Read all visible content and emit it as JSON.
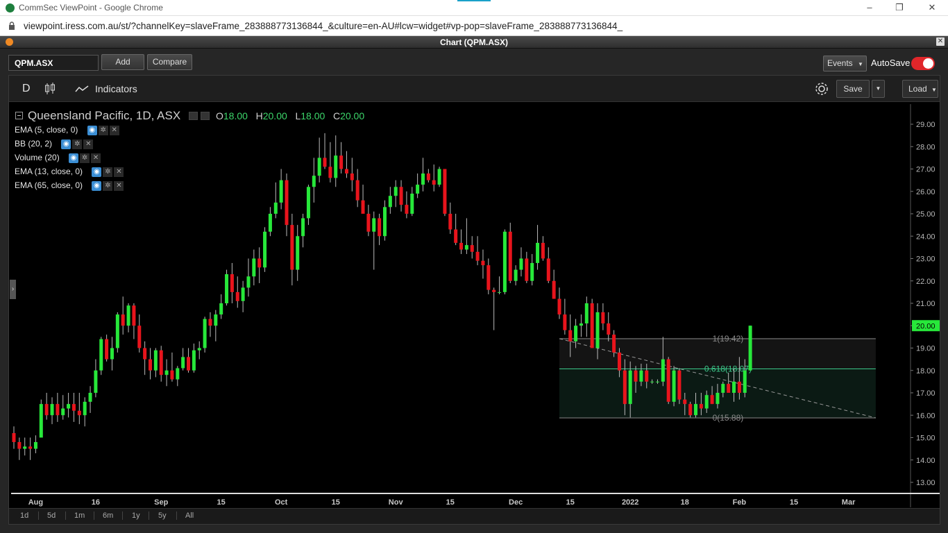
{
  "browser": {
    "window_title": "CommSec ViewPoint - Google Chrome",
    "url": "viewpoint.iress.com.au/st/?channelKey=slaveFrame_283888773136844_&culture=en-AU#lcw=widget#vp-pop=slaveFrame_283888773136844_",
    "controls": {
      "minimize": "–",
      "restore": "❐",
      "close": "✕"
    }
  },
  "widget": {
    "title": "Chart (QPM.ASX)",
    "close_icon": "✕"
  },
  "toolbar": {
    "symbol_value": "QPM.ASX",
    "add_label": "Add",
    "compare_label": "Compare",
    "events_label": "Events",
    "autosave_label": "AutoSave",
    "autosave_on": true
  },
  "chart_toolbar": {
    "period_label": "D",
    "indicators_label": "Indicators",
    "save_label": "Save",
    "load_label": "Load"
  },
  "legend": {
    "title": "Queensland Pacific, 1D, ASX",
    "o_label": "O",
    "o_value": "18.00",
    "h_label": "H",
    "h_value": "20.00",
    "l_label": "L",
    "l_value": "18.00",
    "c_label": "C",
    "c_value": "20.00",
    "studies": [
      "EMA (5, close, 0)",
      "BB (20, 2)",
      "Volume (20)",
      "EMA (13, close, 0)",
      "EMA (65, close, 0)"
    ]
  },
  "range_buttons": [
    "1d",
    "5d",
    "1m",
    "6m",
    "1y",
    "5y",
    "All"
  ],
  "colors": {
    "up": "#27e83a",
    "down": "#e8141c",
    "fib": "#3cc98a",
    "accent": "#f08a24"
  },
  "chart_data": {
    "type": "candlestick",
    "title": "Queensland Pacific, 1D, ASX",
    "ylim": [
      12.5,
      29.5
    ],
    "y_ticks": [
      "29.00",
      "28.00",
      "27.00",
      "26.00",
      "25.00",
      "24.00",
      "23.00",
      "22.00",
      "21.00",
      "20.00",
      "19.00",
      "18.00",
      "17.00",
      "16.00",
      "15.00",
      "14.00",
      "13.00"
    ],
    "x_ticks": [
      {
        "label": "Aug",
        "index": 4
      },
      {
        "label": "16",
        "index": 15
      },
      {
        "label": "Sep",
        "index": 27
      },
      {
        "label": "15",
        "index": 38
      },
      {
        "label": "Oct",
        "index": 49
      },
      {
        "label": "15",
        "index": 59
      },
      {
        "label": "Nov",
        "index": 70
      },
      {
        "label": "15",
        "index": 80
      },
      {
        "label": "Dec",
        "index": 92
      },
      {
        "label": "15",
        "index": 102
      },
      {
        "label": "2022",
        "index": 113
      },
      {
        "label": "18",
        "index": 123
      },
      {
        "label": "Feb",
        "index": 133
      },
      {
        "label": "15",
        "index": 143
      },
      {
        "label": "Mar",
        "index": 153
      }
    ],
    "current_price": "20.00",
    "candles": [
      [
        15.2,
        15.5,
        14.5,
        14.8
      ],
      [
        14.8,
        15.0,
        14.0,
        14.5
      ],
      [
        14.5,
        15.0,
        14.2,
        14.6
      ],
      [
        14.6,
        15.0,
        14.0,
        14.5
      ],
      [
        14.5,
        15.1,
        14.3,
        14.8
      ],
      [
        15.0,
        16.7,
        15.0,
        16.5
      ],
      [
        16.5,
        17.0,
        15.8,
        16.0
      ],
      [
        16.0,
        16.8,
        15.6,
        16.5
      ],
      [
        16.5,
        17.0,
        15.7,
        16.0
      ],
      [
        16.0,
        16.9,
        15.8,
        16.3
      ],
      [
        16.3,
        17.0,
        15.9,
        16.5
      ],
      [
        16.5,
        17.0,
        15.7,
        16.2
      ],
      [
        16.2,
        17.0,
        15.6,
        16.0
      ],
      [
        16.0,
        16.8,
        15.5,
        16.6
      ],
      [
        16.6,
        17.3,
        16.1,
        17.0
      ],
      [
        17.0,
        18.5,
        16.8,
        18.0
      ],
      [
        18.0,
        19.5,
        17.8,
        19.4
      ],
      [
        19.4,
        19.6,
        18.4,
        18.5
      ],
      [
        18.5,
        19.5,
        18.0,
        19.0
      ],
      [
        19.0,
        20.6,
        18.8,
        20.5
      ],
      [
        20.5,
        21.3,
        19.6,
        20.0
      ],
      [
        20.0,
        21.0,
        19.7,
        20.9
      ],
      [
        20.9,
        21.0,
        19.4,
        20.0
      ],
      [
        20.0,
        20.5,
        18.8,
        19.0
      ],
      [
        19.0,
        19.3,
        17.8,
        18.5
      ],
      [
        18.5,
        19.0,
        17.6,
        18.0
      ],
      [
        18.0,
        19.0,
        17.7,
        18.9
      ],
      [
        18.9,
        19.1,
        17.5,
        17.8
      ],
      [
        17.8,
        18.5,
        17.3,
        18.0
      ],
      [
        18.0,
        18.8,
        17.5,
        17.6
      ],
      [
        17.6,
        18.2,
        17.3,
        18.1
      ],
      [
        18.1,
        19.0,
        18.0,
        18.6
      ],
      [
        18.6,
        19.0,
        17.9,
        18.0
      ],
      [
        18.0,
        19.2,
        17.9,
        18.9
      ],
      [
        18.9,
        19.3,
        18.5,
        19.0
      ],
      [
        19.0,
        20.4,
        18.8,
        20.3
      ],
      [
        20.3,
        20.6,
        19.5,
        20.0
      ],
      [
        20.0,
        20.7,
        19.3,
        20.5
      ],
      [
        20.5,
        21.4,
        20.3,
        21.0
      ],
      [
        21.0,
        22.5,
        20.9,
        22.3
      ],
      [
        22.3,
        22.8,
        21.0,
        21.5
      ],
      [
        21.5,
        22.2,
        20.8,
        21.1
      ],
      [
        21.1,
        22.0,
        20.6,
        21.7
      ],
      [
        21.7,
        23.0,
        21.3,
        22.2
      ],
      [
        22.2,
        23.4,
        21.8,
        23.0
      ],
      [
        23.0,
        23.5,
        21.9,
        22.6
      ],
      [
        22.6,
        24.4,
        22.4,
        24.2
      ],
      [
        24.2,
        25.3,
        24.0,
        25.0
      ],
      [
        25.0,
        26.4,
        24.8,
        25.5
      ],
      [
        25.5,
        27.0,
        25.2,
        26.5
      ],
      [
        26.5,
        26.8,
        24.0,
        24.5
      ],
      [
        24.5,
        25.0,
        21.8,
        22.5
      ],
      [
        22.5,
        24.5,
        22.0,
        24.0
      ],
      [
        24.0,
        25.0,
        23.5,
        24.8
      ],
      [
        24.8,
        26.3,
        24.5,
        26.2
      ],
      [
        26.2,
        27.5,
        25.5,
        26.7
      ],
      [
        26.7,
        28.4,
        26.4,
        27.5
      ],
      [
        27.5,
        28.6,
        27.0,
        27.1
      ],
      [
        27.1,
        28.2,
        26.4,
        26.6
      ],
      [
        26.6,
        28.5,
        26.2,
        27.6
      ],
      [
        27.6,
        28.2,
        26.8,
        27.0
      ],
      [
        27.0,
        27.8,
        26.6,
        26.8
      ],
      [
        26.8,
        27.5,
        26.0,
        26.5
      ],
      [
        26.5,
        27.0,
        25.3,
        25.6
      ],
      [
        25.6,
        26.3,
        25.0,
        25.0
      ],
      [
        25.0,
        25.4,
        24.0,
        24.2
      ],
      [
        24.2,
        25.1,
        22.5,
        24.8
      ],
      [
        24.8,
        25.0,
        23.6,
        24.0
      ],
      [
        24.0,
        25.6,
        23.8,
        25.3
      ],
      [
        25.3,
        26.2,
        25.0,
        25.8
      ],
      [
        25.8,
        26.5,
        25.3,
        26.2
      ],
      [
        26.2,
        26.5,
        25.1,
        25.4
      ],
      [
        25.4,
        26.0,
        24.8,
        25.0
      ],
      [
        25.0,
        26.2,
        24.9,
        25.9
      ],
      [
        25.9,
        26.8,
        25.7,
        26.3
      ],
      [
        26.3,
        27.5,
        26.0,
        26.8
      ],
      [
        26.8,
        27.0,
        26.4,
        26.5
      ],
      [
        26.5,
        27.2,
        26.0,
        26.3
      ],
      [
        26.3,
        27.1,
        26.2,
        27.0
      ],
      [
        27.0,
        27.0,
        24.9,
        25.0
      ],
      [
        25.0,
        25.5,
        24.1,
        24.3
      ],
      [
        24.3,
        25.0,
        23.6,
        23.7
      ],
      [
        23.7,
        24.3,
        23.2,
        23.4
      ],
      [
        23.4,
        24.8,
        23.2,
        23.6
      ],
      [
        23.6,
        24.0,
        23.0,
        23.3
      ],
      [
        23.3,
        24.0,
        22.7,
        22.9
      ],
      [
        22.9,
        23.4,
        22.1,
        22.7
      ],
      [
        22.7,
        23.0,
        21.4,
        21.6
      ],
      [
        21.6,
        21.7,
        19.8,
        21.5
      ],
      [
        21.5,
        22.2,
        21.4,
        21.5
      ],
      [
        21.5,
        24.3,
        21.4,
        24.2
      ],
      [
        24.2,
        24.6,
        21.9,
        22.0
      ],
      [
        22.0,
        22.7,
        21.8,
        22.5
      ],
      [
        22.5,
        23.5,
        22.2,
        23.0
      ],
      [
        23.0,
        23.3,
        21.9,
        22.0
      ],
      [
        22.0,
        23.2,
        21.8,
        22.8
      ],
      [
        22.8,
        24.5,
        22.5,
        23.7
      ],
      [
        23.7,
        24.0,
        22.9,
        23.0
      ],
      [
        23.0,
        23.5,
        21.9,
        22.0
      ],
      [
        22.0,
        22.5,
        21.2,
        21.2
      ],
      [
        21.2,
        21.7,
        20.3,
        20.5
      ],
      [
        20.5,
        21.2,
        19.6,
        19.8
      ],
      [
        19.8,
        20.5,
        18.6,
        19.3
      ],
      [
        19.3,
        20.3,
        19.0,
        20.0
      ],
      [
        20.0,
        20.5,
        19.5,
        20.1
      ],
      [
        20.1,
        21.3,
        19.5,
        21.0
      ],
      [
        21.0,
        21.2,
        19.0,
        19.0
      ],
      [
        19.0,
        21.0,
        18.5,
        20.6
      ],
      [
        20.6,
        21.0,
        19.8,
        20.1
      ],
      [
        20.1,
        20.6,
        19.3,
        19.6
      ],
      [
        19.6,
        19.8,
        18.6,
        18.8
      ],
      [
        18.8,
        19.0,
        17.7,
        18.0
      ],
      [
        18.0,
        18.5,
        16.0,
        16.5
      ],
      [
        16.5,
        18.4,
        15.9,
        18.0
      ],
      [
        18.0,
        18.2,
        17.0,
        17.5
      ],
      [
        17.5,
        18.3,
        17.3,
        18.0
      ],
      [
        18.0,
        18.3,
        17.2,
        17.5
      ],
      [
        17.5,
        17.6,
        17.4,
        17.5
      ],
      [
        17.5,
        17.6,
        17.4,
        17.5
      ],
      [
        17.5,
        19.5,
        17.3,
        18.5
      ],
      [
        18.5,
        18.6,
        16.5,
        16.6
      ],
      [
        16.6,
        18.2,
        16.4,
        18.0
      ],
      [
        18.0,
        18.1,
        16.5,
        16.7
      ],
      [
        16.7,
        17.0,
        16.0,
        16.5
      ],
      [
        16.5,
        16.6,
        15.9,
        16.0
      ],
      [
        16.0,
        17.0,
        15.9,
        16.5
      ],
      [
        16.5,
        17.0,
        16.0,
        16.3
      ],
      [
        16.3,
        17.1,
        16.1,
        16.9
      ],
      [
        16.9,
        17.3,
        16.5,
        16.5
      ],
      [
        16.5,
        17.4,
        16.3,
        17.0
      ],
      [
        17.0,
        17.5,
        16.8,
        17.4
      ],
      [
        17.4,
        17.9,
        17.2,
        17.0
      ],
      [
        17.0,
        18.1,
        16.6,
        17.5
      ],
      [
        17.5,
        18.6,
        16.7,
        17.0
      ],
      [
        17.0,
        18.5,
        16.8,
        18.0
      ],
      [
        18.0,
        20.0,
        18.0,
        20.0
      ]
    ],
    "fib_levels": [
      {
        "label": "1(19.42)",
        "value": 19.42
      },
      {
        "label": "0.618(18.07)",
        "value": 18.07
      },
      {
        "label": "0(15.88)",
        "value": 15.88
      }
    ],
    "trend_line": {
      "from": {
        "index": 100,
        "value": 19.42
      },
      "to": {
        "index": 158,
        "value": 15.88
      }
    },
    "fib_range": {
      "from_index": 100,
      "to_index": 158
    }
  }
}
